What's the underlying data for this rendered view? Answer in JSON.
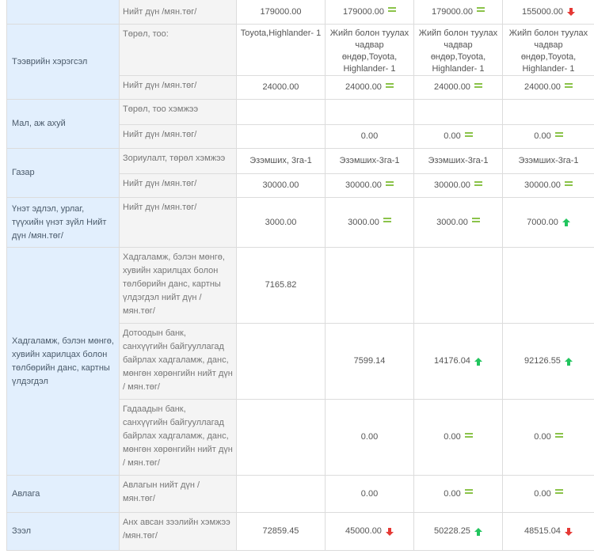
{
  "rows": [
    {
      "category": "",
      "label": "Нийт дүн /мян.төг/",
      "values": [
        {
          "text": "179000.00",
          "icon": ""
        },
        {
          "text": "179000.00",
          "icon": "equal-icon"
        },
        {
          "text": "179000.00",
          "icon": "equal-icon"
        },
        {
          "text": "155000.00",
          "icon": "down-arrow-icon"
        }
      ]
    },
    {
      "category": "Тээврийн хэрэгсэл",
      "label": "Төрөл, тоо:",
      "values": [
        {
          "text": "Toyota,Highlander- 1",
          "icon": ""
        },
        {
          "text": "Жийп болон туулах чадвар өндөр,Toyota, Highlander- 1",
          "icon": ""
        },
        {
          "text": "Жийп болон туулах чадвар өндөр,Toyota, Highlander- 1",
          "icon": ""
        },
        {
          "text": "Жийп болон туулах чадвар өндөр,Toyota, Highlander- 1",
          "icon": ""
        }
      ]
    },
    {
      "category": "",
      "label": "Нийт дүн /мян.төг/",
      "values": [
        {
          "text": "24000.00",
          "icon": ""
        },
        {
          "text": "24000.00",
          "icon": "equal-icon"
        },
        {
          "text": "24000.00",
          "icon": "equal-icon"
        },
        {
          "text": "24000.00",
          "icon": "equal-icon"
        }
      ]
    },
    {
      "category": "Мал, аж ахуй",
      "label": "Төрөл, тоо хэмжээ",
      "values": [
        {
          "text": "",
          "icon": ""
        },
        {
          "text": "",
          "icon": ""
        },
        {
          "text": "",
          "icon": ""
        },
        {
          "text": "",
          "icon": ""
        }
      ]
    },
    {
      "category": "",
      "label": "Нийт дүн /мян.төг/",
      "values": [
        {
          "text": "",
          "icon": ""
        },
        {
          "text": "0.00",
          "icon": ""
        },
        {
          "text": "0.00",
          "icon": "equal-icon"
        },
        {
          "text": "0.00",
          "icon": "equal-icon"
        }
      ]
    },
    {
      "category": "Газар",
      "label": "Зориулалт, төрөл хэмжээ",
      "values": [
        {
          "text": "Эзэмших, 3га-1",
          "icon": ""
        },
        {
          "text": "Эзэмших-3га-1",
          "icon": ""
        },
        {
          "text": "Эзэмших-3га-1",
          "icon": ""
        },
        {
          "text": "Эзэмших-3га-1",
          "icon": ""
        }
      ]
    },
    {
      "category": "",
      "label": "Нийт дүн /мян.төг/",
      "values": [
        {
          "text": "30000.00",
          "icon": ""
        },
        {
          "text": "30000.00",
          "icon": "equal-icon"
        },
        {
          "text": "30000.00",
          "icon": "equal-icon"
        },
        {
          "text": "30000.00",
          "icon": "equal-icon"
        }
      ]
    },
    {
      "category": "Үнэт эдлэл, урлаг, түүхийн үнэт зүйл Нийт дүн /мян.төг/",
      "label": "Нийт дүн /мян.төг/",
      "values": [
        {
          "text": "3000.00",
          "icon": ""
        },
        {
          "text": "3000.00",
          "icon": "equal-icon"
        },
        {
          "text": "3000.00",
          "icon": "equal-icon"
        },
        {
          "text": "7000.00",
          "icon": "up-arrow-icon"
        }
      ]
    },
    {
      "category": "Хадгаламж, бэлэн мөнгө, хувийн харилцах болон төлбөрийн данс, картны үлдэгдэл",
      "label": "Хадгаламж, бэлэн мөнгө, хувийн харилцах болон төлбөрийн данс, картны үлдэгдэл нийт дүн / мян.төг/",
      "values": [
        {
          "text": "7165.82",
          "icon": ""
        },
        {
          "text": "",
          "icon": ""
        },
        {
          "text": "",
          "icon": ""
        },
        {
          "text": "",
          "icon": ""
        }
      ]
    },
    {
      "category": "",
      "label": "Дотоодын банк, санхүүгийн байгууллагад байрлах хадгаламж, данс, мөнгөн хөрөнгийн нийт дүн / мян.төг/",
      "values": [
        {
          "text": "",
          "icon": ""
        },
        {
          "text": "7599.14",
          "icon": ""
        },
        {
          "text": "14176.04",
          "icon": "up-arrow-icon"
        },
        {
          "text": "92126.55",
          "icon": "up-arrow-icon"
        }
      ]
    },
    {
      "category": "",
      "label": "Гадаадын банк, санхүүгийн байгууллагад байрлах хадгаламж, данс, мөнгөн хөрөнгийн нийт дүн / мян.төг/",
      "values": [
        {
          "text": "",
          "icon": ""
        },
        {
          "text": "0.00",
          "icon": ""
        },
        {
          "text": "0.00",
          "icon": "equal-icon"
        },
        {
          "text": "0.00",
          "icon": "equal-icon"
        }
      ]
    },
    {
      "category": "Авлага",
      "label": "Авлагын нийт дүн / мян.төг/",
      "values": [
        {
          "text": "",
          "icon": ""
        },
        {
          "text": "0.00",
          "icon": ""
        },
        {
          "text": "0.00",
          "icon": "equal-icon"
        },
        {
          "text": "0.00",
          "icon": "equal-icon"
        }
      ]
    },
    {
      "category": "Зээл",
      "label": "Анх авсан зээлийн хэмжээ /мян.төг/",
      "values": [
        {
          "text": "72859.45",
          "icon": ""
        },
        {
          "text": "45000.00",
          "icon": "down-arrow-icon"
        },
        {
          "text": "50228.25",
          "icon": "up-arrow-icon"
        },
        {
          "text": "48515.04",
          "icon": "down-arrow-icon"
        }
      ]
    }
  ],
  "colors": {
    "equal": "#8bc34a",
    "up": "#22c55e",
    "down": "#e53935",
    "category_bg": "#e2effd"
  }
}
